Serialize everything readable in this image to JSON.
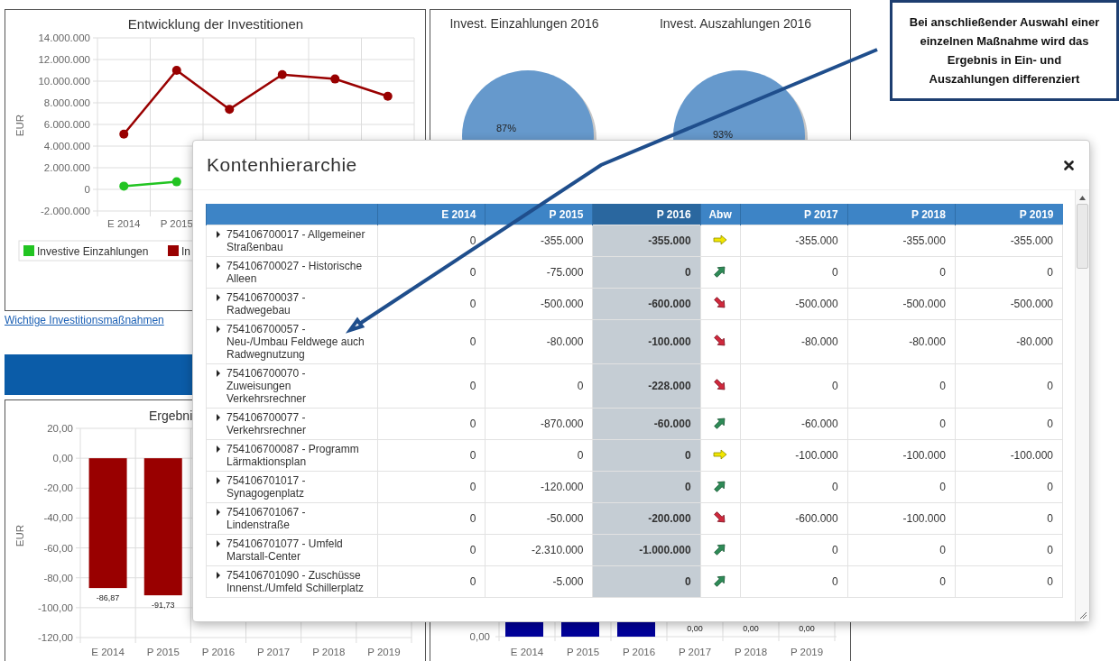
{
  "investment_chart": {
    "chart_data": {
      "type": "line",
      "title": "Entwicklung der Investitionen",
      "ylabel": "EUR",
      "grid": true,
      "legend": "bottom",
      "categories": [
        "E 2014",
        "P 2015",
        null,
        null,
        null,
        null
      ],
      "ylim": [
        -2000000,
        14000000
      ],
      "yticks": [
        {
          "value": 14000000,
          "label": "14.000.000"
        },
        {
          "value": 12000000,
          "label": "12.000.000"
        },
        {
          "value": 10000000,
          "label": "10.000.000"
        },
        {
          "value": 8000000,
          "label": "8.000.000"
        },
        {
          "value": 6000000,
          "label": "6.000.000"
        },
        {
          "value": 4000000,
          "label": "4.000.000"
        },
        {
          "value": 2000000,
          "label": "2.000.000"
        },
        {
          "value": 0,
          "label": "0"
        },
        {
          "value": -2000000,
          "label": "-2.000.000"
        }
      ],
      "series": [
        {
          "name": "Investive Einzahlungen",
          "color": "#22c422",
          "marker": "circle",
          "values": [
            300000,
            700000,
            null,
            null,
            null,
            null
          ]
        },
        {
          "name": "In",
          "color": "#990000",
          "marker": "circle",
          "values": [
            5100000,
            11000000,
            7400000,
            10600000,
            10200000,
            8600000
          ]
        }
      ]
    }
  },
  "link": "Wichtige Investitionsmaßnahmen",
  "payments_panel": {
    "pies": [
      {
        "title": "Invest. Einzahlungen 2016",
        "label": "87%"
      },
      {
        "title": "Invest. Auszahlungen 2016",
        "label": "93%"
      }
    ]
  },
  "result_chart": {
    "chart_data": {
      "type": "bar",
      "title": "Ergebni",
      "ylabel": "EUR",
      "grid": true,
      "categories": [
        "E 2014",
        "P 2015",
        "P 2016",
        "P 2017",
        "P 2018",
        "P 2019"
      ],
      "ylim": [
        -120,
        20
      ],
      "yticks": [
        {
          "value": 20,
          "label": "20,00"
        },
        {
          "value": 0,
          "label": "0,00"
        },
        {
          "value": -20,
          "label": "-20,00"
        },
        {
          "value": -40,
          "label": "-40,00"
        },
        {
          "value": -60,
          "label": "-60,00"
        },
        {
          "value": -80,
          "label": "-80,00"
        },
        {
          "value": -100,
          "label": "-100,00"
        },
        {
          "value": -120,
          "label": "-120,00"
        }
      ],
      "values": [
        -86.87,
        -91.73,
        null,
        null,
        null,
        null
      ],
      "value_labels": [
        "-86,87",
        "-91,73",
        null,
        null,
        null,
        null
      ]
    }
  },
  "cashflow_chart": {
    "zero_tick": "0,00",
    "categories": [
      "E 2014",
      "P 2015",
      "P 2016",
      "P 2017",
      "P 2018",
      "P 2019"
    ],
    "value_labels": [
      "0,00",
      "0,00",
      "0,00"
    ]
  },
  "modal": {
    "title": "Kontenhierarchie",
    "columns": [
      {
        "label": "E 2014",
        "kind": "value",
        "highlighted": false
      },
      {
        "label": "P 2015",
        "kind": "value",
        "highlighted": false
      },
      {
        "label": "P 2016",
        "kind": "value",
        "highlighted": true
      },
      {
        "label": "Abw",
        "kind": "trend",
        "highlighted": false
      },
      {
        "label": "P 2017",
        "kind": "value",
        "highlighted": false
      },
      {
        "label": "P 2018",
        "kind": "value",
        "highlighted": false
      },
      {
        "label": "P 2019",
        "kind": "value",
        "highlighted": false
      }
    ],
    "rows": [
      {
        "name": "754106700017 - Allgemeiner Straßenbau",
        "expanded": false,
        "trend": {
          "kind": "right"
        },
        "values": [
          "0",
          "-355.000",
          "-355.000",
          "-355.000",
          "-355.000",
          "-355.000"
        ]
      },
      {
        "name": "754106700027 - Historische Alleen",
        "expanded": false,
        "trend": {
          "kind": "up"
        },
        "values": [
          "0",
          "-75.000",
          "0",
          "0",
          "0",
          "0"
        ]
      },
      {
        "name": "754106700037 - Radwegebau",
        "expanded": false,
        "trend": {
          "kind": "down"
        },
        "values": [
          "0",
          "-500.000",
          "-600.000",
          "-500.000",
          "-500.000",
          "-500.000"
        ]
      },
      {
        "name": "754106700057 - Neu-/Umbau Feldwege auch Radwegnutzung",
        "expanded": false,
        "trend": {
          "kind": "down"
        },
        "values": [
          "0",
          "-80.000",
          "-100.000",
          "-80.000",
          "-80.000",
          "-80.000"
        ]
      },
      {
        "name": "754106700070 - Zuweisungen Verkehrsrechner",
        "expanded": false,
        "trend": {
          "kind": "down"
        },
        "values": [
          "0",
          "0",
          "-228.000",
          "0",
          "0",
          "0"
        ]
      },
      {
        "name": "754106700077 - Verkehrsrechner",
        "expanded": false,
        "trend": {
          "kind": "up"
        },
        "values": [
          "0",
          "-870.000",
          "-60.000",
          "-60.000",
          "0",
          "0"
        ]
      },
      {
        "name": "754106700087 - Programm Lärmaktionsplan",
        "expanded": false,
        "trend": {
          "kind": "right"
        },
        "values": [
          "0",
          "0",
          "0",
          "-100.000",
          "-100.000",
          "-100.000"
        ]
      },
      {
        "name": "754106701017 - Synagogenplatz",
        "expanded": false,
        "trend": {
          "kind": "up"
        },
        "values": [
          "0",
          "-120.000",
          "0",
          "0",
          "0",
          "0"
        ]
      },
      {
        "name": "754106701067 - Lindenstraße",
        "expanded": false,
        "trend": {
          "kind": "down"
        },
        "values": [
          "0",
          "-50.000",
          "-200.000",
          "-600.000",
          "-100.000",
          "0"
        ]
      },
      {
        "name": "754106701077 - Umfeld Marstall-Center",
        "expanded": false,
        "trend": {
          "kind": "up"
        },
        "values": [
          "0",
          "-2.310.000",
          "-1.000.000",
          "0",
          "0",
          "0"
        ]
      },
      {
        "name": "754106701090 - Zuschüsse Innenst./Umfeld Schillerplatz",
        "expanded": false,
        "trend": {
          "kind": "up"
        },
        "values": [
          "0",
          "-5.000",
          "0",
          "0",
          "0",
          "0"
        ]
      }
    ]
  },
  "callout": {
    "text": "Bei anschließender Auswahl einer einzelnen Maßnahme wird das Ergebnis in Ein- und Auszahlungen differenziert"
  }
}
